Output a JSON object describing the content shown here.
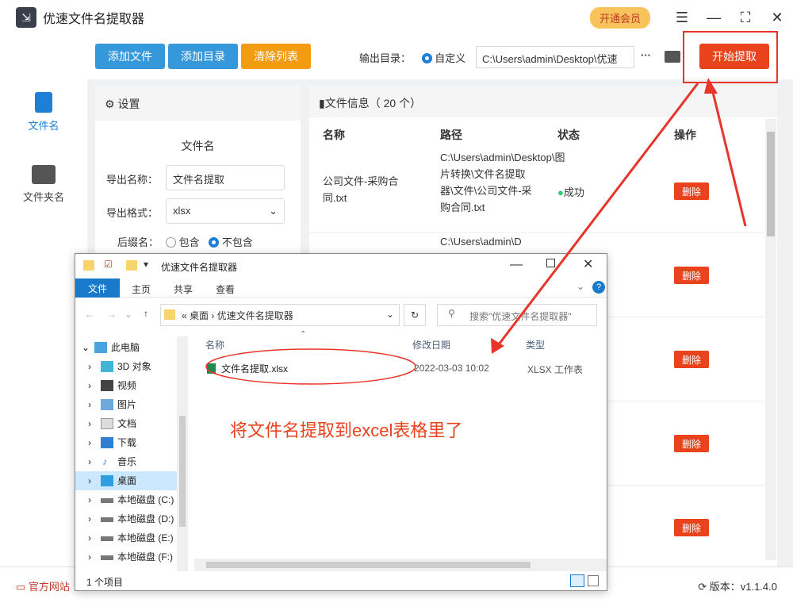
{
  "app": {
    "title": "优速文件名提取器",
    "vip_label": "开通会员",
    "version": "版本：v1.1.4.0",
    "site_label": "官方网站"
  },
  "sidebar": {
    "items": [
      {
        "label": "文件名"
      },
      {
        "label": "文件夹名"
      }
    ]
  },
  "toolbar": {
    "add_file": "添加文件",
    "add_dir": "添加目录",
    "clear_list": "清除列表",
    "output_dir_label": "输出目录：",
    "custom_label": "自定义",
    "path": "C:\\Users\\admin\\Desktop\\优速",
    "more": "···",
    "start": "开始提取"
  },
  "settings": {
    "header": "设置",
    "section": "文件名",
    "export_name_label": "导出名称：",
    "export_name": "文件名提取",
    "export_format_label": "导出格式：",
    "export_format": "xlsx",
    "suffix_label": "后缀名：",
    "suffix_include": "包含",
    "suffix_exclude": "不包含"
  },
  "fileinfo": {
    "header": "文件信息（ 20 个）",
    "columns": [
      "名称",
      "路径",
      "状态",
      "操作"
    ],
    "rows": [
      {
        "name": "公司文件-采购合同.txt",
        "path": "C:\\Users\\admin\\Desktop\\图片转换\\文件名提取器\\文件\\公司文件-采购合同.txt",
        "status": "成功",
        "action": "删除"
      },
      {
        "path": "C:\\Users\\admin\\D",
        "action": "删除"
      },
      {
        "action": "删除"
      },
      {
        "action": "删除"
      },
      {
        "action": "删除"
      }
    ]
  },
  "explorer": {
    "title": "优速文件名提取器",
    "tabs": [
      "文件",
      "主页",
      "共享",
      "查看"
    ],
    "breadcrumb": [
      "桌面",
      "优速文件名提取器"
    ],
    "search_placeholder": "搜索\"优速文件名提取器\"",
    "tree": [
      "此电脑",
      "3D 对象",
      "视频",
      "图片",
      "文档",
      "下载",
      "音乐",
      "桌面",
      "本地磁盘 (C:)",
      "本地磁盘 (D:)",
      "本地磁盘 (E:)",
      "本地磁盘 (F:)"
    ],
    "columns": [
      "名称",
      "修改日期",
      "类型"
    ],
    "file": {
      "name": "文件名提取.xlsx",
      "date": "2022-03-03 10:02",
      "type": "XLSX 工作表"
    },
    "status": "1 个项目"
  },
  "annotation": "将文件名提取到excel表格里了"
}
